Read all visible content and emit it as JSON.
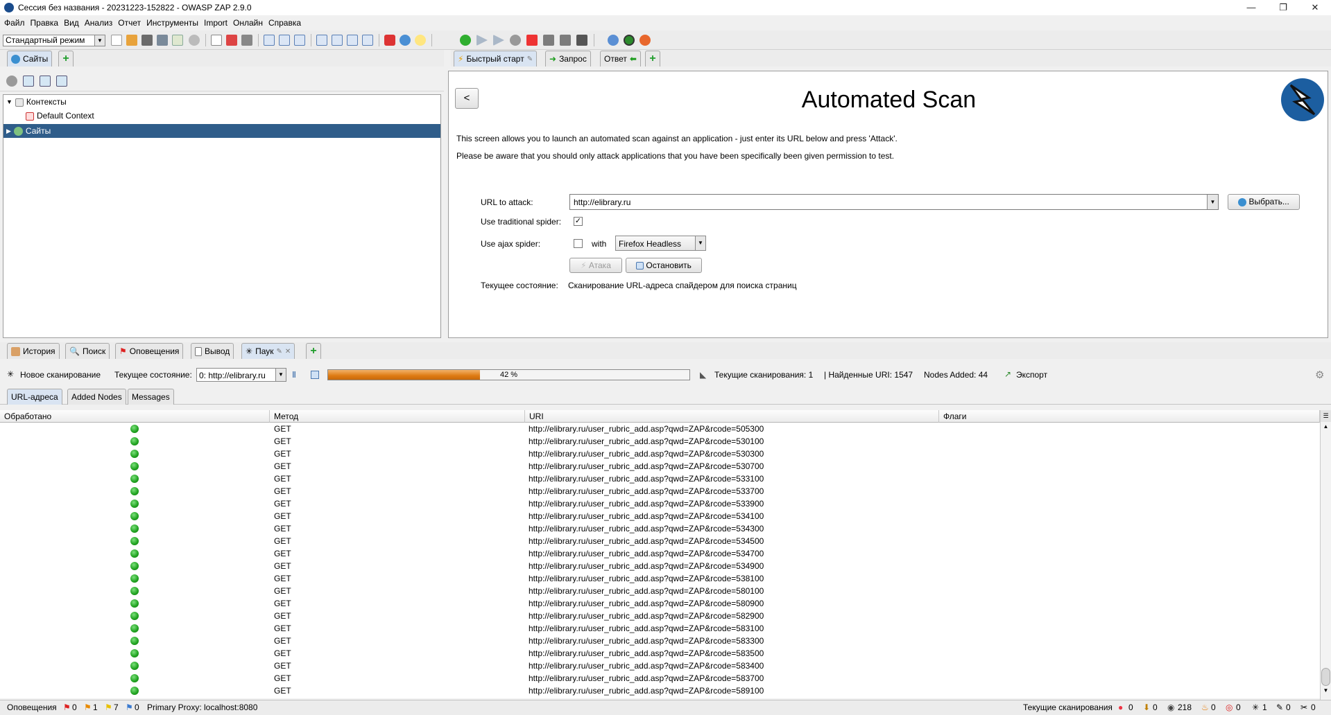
{
  "window": {
    "title": "Сессия без названия - 20231223-152822 - OWASP ZAP 2.9.0",
    "minimize": "—",
    "maximize": "❐",
    "close": "✕"
  },
  "menu": [
    "Файл",
    "Правка",
    "Вид",
    "Анализ",
    "Отчет",
    "Инструменты",
    "Import",
    "Онлайн",
    "Справка"
  ],
  "toolbar": {
    "mode": "Стандартный режим"
  },
  "left_tabs": {
    "sites": "Сайты"
  },
  "tree": {
    "contexts": "Контексты",
    "default_context": "Default Context",
    "sites": "Сайты"
  },
  "right_tabs": {
    "quick_start": "Быстрый старт",
    "request": "Запрос",
    "response": "Ответ"
  },
  "quickstart": {
    "back": "<",
    "title": "Automated Scan",
    "desc1": "This screen allows you to launch an automated scan against  an application - just enter its URL below and press 'Attack'.",
    "desc2": "Please be aware that you should only attack applications that you have been specifically been given permission to test.",
    "url_label": "URL to attack:",
    "url_value": "http://elibrary.ru",
    "choose_btn": "Выбрать...",
    "trad_spider_label": "Use traditional spider:",
    "trad_spider_checked": true,
    "ajax_spider_label": "Use ajax spider:",
    "ajax_with": "with",
    "browser": "Firefox Headless",
    "attack_btn": "Атака",
    "stop_btn": "Остановить",
    "status_label": "Текущее состояние:",
    "status_value": "Сканирование URL-адреса спайдером для поиска страниц"
  },
  "bottom_tabs": {
    "history": "История",
    "search": "Поиск",
    "alerts": "Оповещения",
    "output": "Вывод",
    "spider": "Паук"
  },
  "spider_bar": {
    "new_scan": "Новое сканирование",
    "status_label": "Текущее состояние:",
    "scan_target": "0: http://elibrary.ru",
    "progress_pct": 42,
    "progress_text": "42 %",
    "current_scans": "Текущие сканирования: 1",
    "found_uri": "| Найденные URI: 1547",
    "nodes_added": "Nodes Added: 44",
    "export": "Экспорт"
  },
  "sub_tabs": {
    "urls": "URL-адреса",
    "added_nodes": "Added Nodes",
    "messages": "Messages"
  },
  "table": {
    "headers": [
      "Обработано",
      "Метод",
      "URI",
      "Флаги"
    ],
    "method": "GET",
    "rows": [
      "http://elibrary.ru/user_rubric_add.asp?qwd=ZAP&rcode=505300",
      "http://elibrary.ru/user_rubric_add.asp?qwd=ZAP&rcode=530100",
      "http://elibrary.ru/user_rubric_add.asp?qwd=ZAP&rcode=530300",
      "http://elibrary.ru/user_rubric_add.asp?qwd=ZAP&rcode=530700",
      "http://elibrary.ru/user_rubric_add.asp?qwd=ZAP&rcode=533100",
      "http://elibrary.ru/user_rubric_add.asp?qwd=ZAP&rcode=533700",
      "http://elibrary.ru/user_rubric_add.asp?qwd=ZAP&rcode=533900",
      "http://elibrary.ru/user_rubric_add.asp?qwd=ZAP&rcode=534100",
      "http://elibrary.ru/user_rubric_add.asp?qwd=ZAP&rcode=534300",
      "http://elibrary.ru/user_rubric_add.asp?qwd=ZAP&rcode=534500",
      "http://elibrary.ru/user_rubric_add.asp?qwd=ZAP&rcode=534700",
      "http://elibrary.ru/user_rubric_add.asp?qwd=ZAP&rcode=534900",
      "http://elibrary.ru/user_rubric_add.asp?qwd=ZAP&rcode=538100",
      "http://elibrary.ru/user_rubric_add.asp?qwd=ZAP&rcode=580100",
      "http://elibrary.ru/user_rubric_add.asp?qwd=ZAP&rcode=580900",
      "http://elibrary.ru/user_rubric_add.asp?qwd=ZAP&rcode=582900",
      "http://elibrary.ru/user_rubric_add.asp?qwd=ZAP&rcode=583100",
      "http://elibrary.ru/user_rubric_add.asp?qwd=ZAP&rcode=583300",
      "http://elibrary.ru/user_rubric_add.asp?qwd=ZAP&rcode=583500",
      "http://elibrary.ru/user_rubric_add.asp?qwd=ZAP&rcode=583400",
      "http://elibrary.ru/user_rubric_add.asp?qwd=ZAP&rcode=583700",
      "http://elibrary.ru/user_rubric_add.asp?qwd=ZAP&rcode=589100"
    ]
  },
  "status": {
    "alerts_label": "Оповещения",
    "alerts_high": "0",
    "alerts_medium": "1",
    "alerts_low": "7",
    "alerts_info": "0",
    "proxy": "Primary Proxy: localhost:8080",
    "scans_label": "Текущие сканирования",
    "s1": "0",
    "s2": "0",
    "s3": "218",
    "s4": "0",
    "s5": "0",
    "s6": "1",
    "s7": "0",
    "s8": "0"
  }
}
